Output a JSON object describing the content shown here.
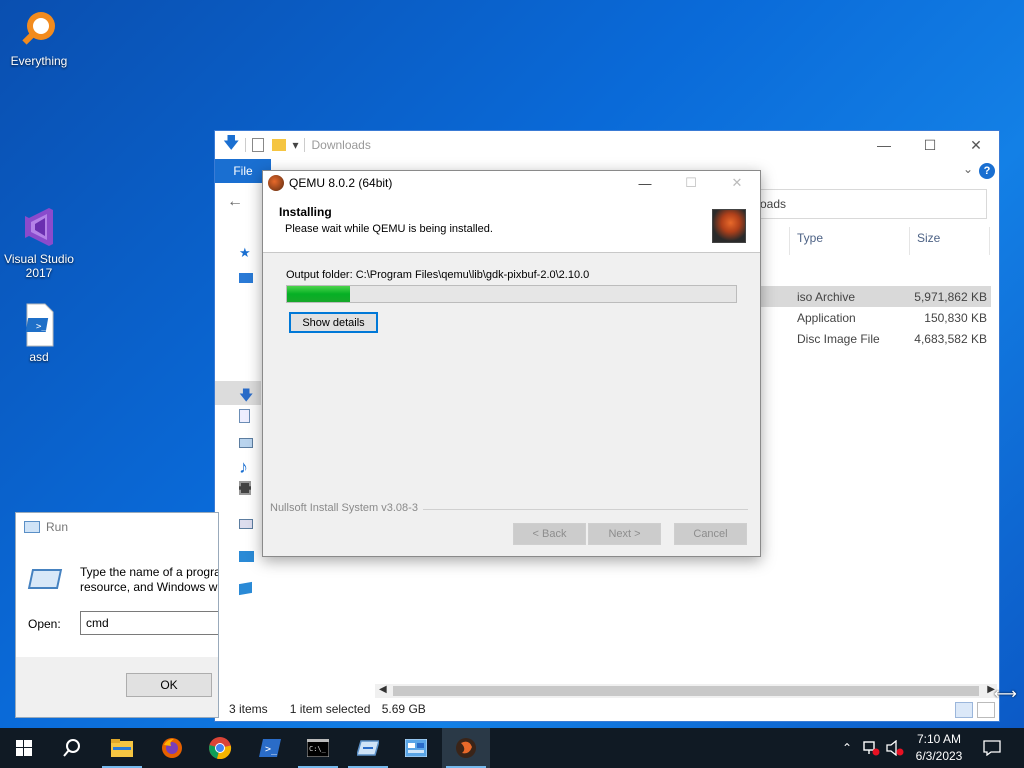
{
  "desktop": {
    "icons": [
      {
        "label": "Everything"
      },
      {
        "label": "Visual Studio 2017"
      },
      {
        "label": "asd"
      }
    ]
  },
  "explorer": {
    "title": "Downloads",
    "file_tab": "File",
    "search_text": "oads",
    "columns": {
      "type": "Type",
      "size": "Size"
    },
    "rows": [
      {
        "type": "iso Archive",
        "size": "5,971,862 KB",
        "selected": true
      },
      {
        "type": "Application",
        "size": "150,830 KB",
        "selected": false
      },
      {
        "type": "Disc Image File",
        "size": "4,683,582 KB",
        "selected": false
      }
    ],
    "status": {
      "items": "3 items",
      "selected": "1 item selected",
      "size": "5.69 GB"
    }
  },
  "run_dialog": {
    "title": "Run",
    "description_line1": "Type the name of a progra",
    "description_line2": "resource, and Windows w",
    "open_label": "Open:",
    "open_value": "cmd",
    "ok_label": "OK"
  },
  "installer": {
    "title": "QEMU 8.0.2 (64bit)",
    "heading": "Installing",
    "subheading": "Please wait while QEMU is being installed.",
    "output_folder": "Output folder: C:\\Program Files\\qemu\\lib\\gdk-pixbuf-2.0\\2.10.0",
    "progress_fraction": 0.14,
    "show_details_label": "Show details",
    "branding": "Nullsoft Install System v3.08-3",
    "back_label": "< Back",
    "next_label": "Next >",
    "cancel_label": "Cancel"
  },
  "taskbar": {
    "time": "7:10 AM",
    "date": "6/3/2023"
  },
  "colors": {
    "accent": "#0078d7",
    "progress_green": "#06b025",
    "taskbar_bg": "#101a24"
  }
}
